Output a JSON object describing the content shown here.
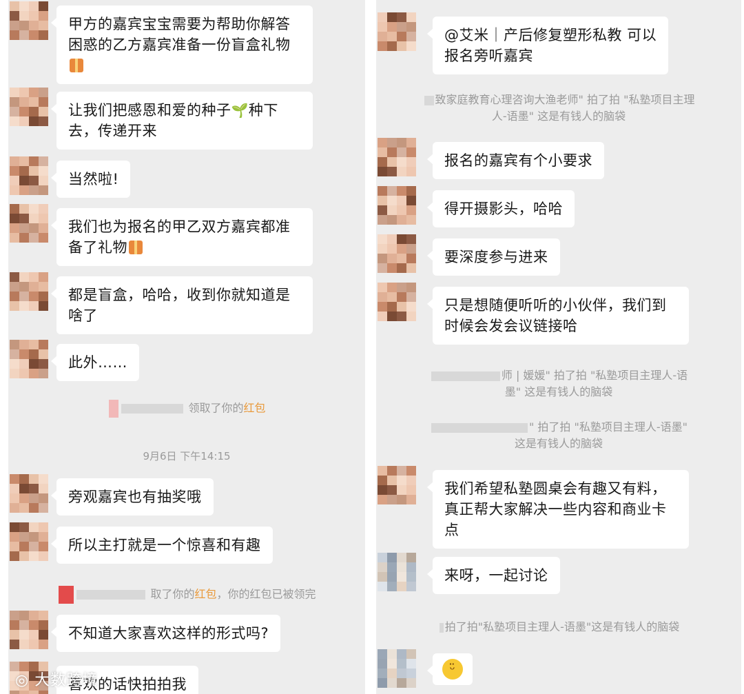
{
  "left": {
    "m1": {
      "line1": "甲方的嘉宾宝宝需要为帮助你解答",
      "line2": "困惑的乙方嘉宾准备一份盲盒礼物"
    },
    "m2": {
      "line1_a": "让我们把感恩和爱的种子",
      "sprout": "🌱",
      "line1_b": "种下",
      "line2": "去，传递开来"
    },
    "m3": {
      "text": "当然啦!"
    },
    "m4": {
      "line1": "我们也为报名的甲乙双方嘉宾都准",
      "line2": "备了礼物"
    },
    "m5": {
      "line1": "都是盲盒，哈哈，收到你就知道是",
      "line2": "啥了"
    },
    "m6": {
      "text": "此外……"
    },
    "sys1": {
      "text": "领取了你的",
      "highlight": "红包"
    },
    "timestamp": "9月6日 下午14:15",
    "m7": {
      "text": "旁观嘉宾也有抽奖哦"
    },
    "m8": {
      "text": "所以主打就是一个惊喜和有趣"
    },
    "sys2": {
      "prefix": "取了你的",
      "highlight": "红包",
      "suffix": "，你的红包已被领完"
    },
    "m9": {
      "text": "不知道大家喜欢这样的形式吗?"
    },
    "m10": {
      "text": "喜欢的话快拍拍我"
    },
    "watermark": "大数跨境"
  },
  "right": {
    "m1": {
      "line1": "@艾米｜产后修复塑形私教  可以",
      "line2": "报名旁听嘉宾"
    },
    "sys1": {
      "line1": "致家庭教育心理咨询大渔老师\" 拍了拍 \"私塾项目主理",
      "line2": "人-语墨\" 这是有钱人的脑袋"
    },
    "m2": {
      "text": "报名的嘉宾有个小要求"
    },
    "m3": {
      "text": "得开摄影头，哈哈"
    },
    "m4": {
      "text": "要深度参与进来"
    },
    "m5": {
      "line1": "只是想随便听听的小伙伴，我们到",
      "line2": "时候会发会议链接哈"
    },
    "sys2": {
      "line1": "师 | 媛媛\" 拍了拍 \"私塾项目主理人-语",
      "line2": "墨\" 这是有钱人的脑袋"
    },
    "sys3": {
      "line1": "\" 拍了拍 \"私塾项目主理人-语墨\"",
      "line2": "这是有钱人的脑袋"
    },
    "m6": {
      "line1": "我们希望私塾圆桌会有趣又有料，",
      "line2": "真正帮大家解决一些内容和商业卡",
      "line3": "点"
    },
    "m7": {
      "text": "来呀，一起讨论"
    },
    "sys4": {
      "text": "拍了拍\"私塾项目主理人-语墨\"这是有钱人的脑袋"
    },
    "m8": {
      "emoji": "😁"
    }
  },
  "colors": {
    "background": "#ededed",
    "bubble": "#ffffff",
    "system_text": "#9a9a9a",
    "red_packet": "#e99a3c"
  },
  "icons": {
    "gift": "gift-icon",
    "sprout": "sprout-icon",
    "grin": "grin-emoji-icon"
  }
}
